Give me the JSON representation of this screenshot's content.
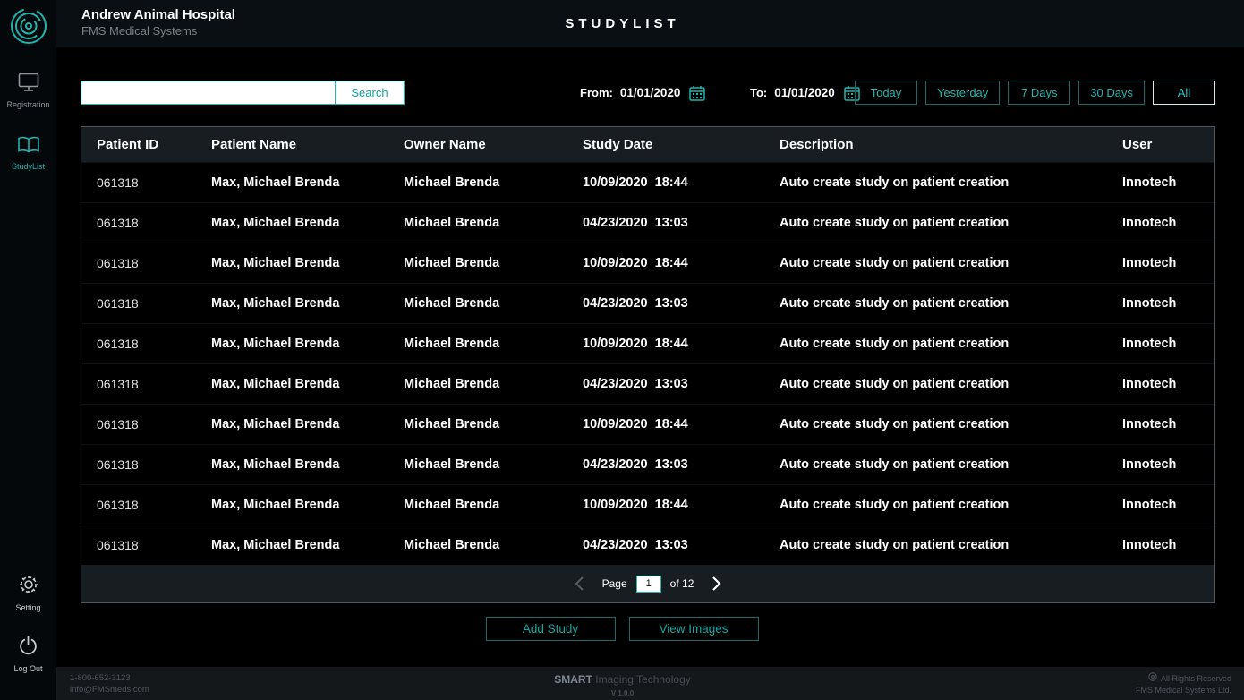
{
  "colors": {
    "accent": "#1fb6ae"
  },
  "sidebar": {
    "logo_icon": "fms-logo-icon",
    "items": [
      {
        "label": "Registration",
        "icon": "monitor-icon",
        "active": false
      },
      {
        "label": "StudyList",
        "icon": "book-icon",
        "active": true
      }
    ],
    "bottom": [
      {
        "label": "Setting",
        "icon": "gear-icon"
      },
      {
        "label": "Log Out",
        "icon": "power-icon"
      }
    ]
  },
  "header": {
    "hospital_name": "Andrew Animal Hospital",
    "system_name": "FMS Medical Systems",
    "page_title": "STUDYLIST"
  },
  "filters": {
    "search_value": "",
    "search_button": "Search",
    "from_label": "From:",
    "from_value": "01/01/2020",
    "to_label": "To:",
    "to_value": "01/01/2020",
    "range_buttons": [
      "Today",
      "Yesterday",
      "7 Days",
      "30 Days",
      "All"
    ]
  },
  "table": {
    "columns": [
      "Patient ID",
      "Patient Name",
      "Owner Name",
      "Study Date",
      "Description",
      "User"
    ],
    "rows": [
      {
        "patient_id": "061318",
        "patient_name": "Max, Michael Brenda",
        "owner_name": "Michael Brenda",
        "study_date": "10/09/2020  18:44",
        "description": "Auto create study on patient creation",
        "user": "Innotech"
      },
      {
        "patient_id": "061318",
        "patient_name": "Max, Michael Brenda",
        "owner_name": "Michael Brenda",
        "study_date": "04/23/2020  13:03",
        "description": "Auto create study on patient creation",
        "user": "Innotech"
      },
      {
        "patient_id": "061318",
        "patient_name": "Max, Michael Brenda",
        "owner_name": "Michael Brenda",
        "study_date": "10/09/2020  18:44",
        "description": "Auto create study on patient creation",
        "user": "Innotech"
      },
      {
        "patient_id": "061318",
        "patient_name": "Max, Michael Brenda",
        "owner_name": "Michael Brenda",
        "study_date": "04/23/2020  13:03",
        "description": "Auto create study on patient creation",
        "user": "Innotech"
      },
      {
        "patient_id": "061318",
        "patient_name": "Max, Michael Brenda",
        "owner_name": "Michael Brenda",
        "study_date": "10/09/2020  18:44",
        "description": "Auto create study on patient creation",
        "user": "Innotech"
      },
      {
        "patient_id": "061318",
        "patient_name": "Max, Michael Brenda",
        "owner_name": "Michael Brenda",
        "study_date": "04/23/2020  13:03",
        "description": "Auto create study on patient creation",
        "user": "Innotech"
      },
      {
        "patient_id": "061318",
        "patient_name": "Max, Michael Brenda",
        "owner_name": "Michael Brenda",
        "study_date": "10/09/2020  18:44",
        "description": "Auto create study on patient creation",
        "user": "Innotech"
      },
      {
        "patient_id": "061318",
        "patient_name": "Max, Michael Brenda",
        "owner_name": "Michael Brenda",
        "study_date": "04/23/2020  13:03",
        "description": "Auto create study on patient creation",
        "user": "Innotech"
      },
      {
        "patient_id": "061318",
        "patient_name": "Max, Michael Brenda",
        "owner_name": "Michael Brenda",
        "study_date": "10/09/2020  18:44",
        "description": "Auto create study on patient creation",
        "user": "Innotech"
      },
      {
        "patient_id": "061318",
        "patient_name": "Max, Michael Brenda",
        "owner_name": "Michael Brenda",
        "study_date": "04/23/2020  13:03",
        "description": "Auto create study on patient creation",
        "user": "Innotech"
      }
    ]
  },
  "pagination": {
    "page_label": "Page",
    "current_page": "1",
    "of_label": "of",
    "total_pages": "12"
  },
  "actions": {
    "add_study": "Add Study",
    "view_images": "View Images"
  },
  "footer": {
    "phone": "1-800-652-3123",
    "email": "info@FMSmeds.com",
    "brand_bold": "SMART",
    "brand_rest": " Imaging Technology",
    "version": "V 1.0.0",
    "rights_line1": "All Rights Reserved",
    "rights_line2": "FMS Medical Systems Ltd."
  }
}
